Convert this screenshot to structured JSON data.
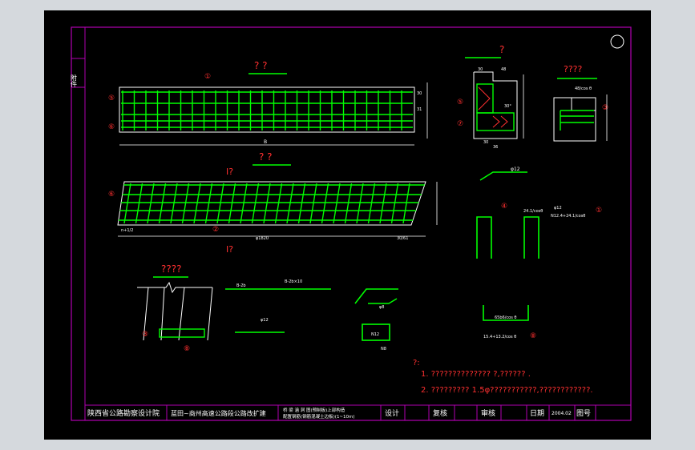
{
  "colors": {
    "background": "#d5d9dd",
    "sheet": "#000000",
    "border": "#b000b0",
    "rebar": "#00ff00",
    "line": "#ffffff",
    "dimension": "#ff3030",
    "title": "#ff3030",
    "text": "#ffffff"
  },
  "side_tab": "附件",
  "views": {
    "top_title": "? ?",
    "mid_title": "? ?",
    "section_title": "?",
    "detail_title": "????",
    "cut_mark_1": "I?",
    "cut_mark_2": "I?",
    "detail_a_title": "????",
    "mid_bottom_label": "n+1/2",
    "small_hook_label": "φ12",
    "bar_labels": {
      "b1": "B-2b",
      "b2": "B-2b×10",
      "b3": "φ12",
      "b4": "φ8",
      "b5": "N8",
      "b6": "N12",
      "b7": "65b6/cos θ",
      "b8": "15.4+13.2/cos θ",
      "b9": "24.1/cosθ",
      "b10": "N12.4+24.1/cosθ",
      "b11": "φ12"
    },
    "dim_labels": {
      "top_len": "B",
      "right_1": "30",
      "right_2": "31",
      "sec_1": "30",
      "sec_2": "48",
      "sec_3": "30",
      "sec_4": "36",
      "sec_5": "30°",
      "det_1": "48/cos θ",
      "mid_len": "φ1820",
      "mid_right": "30/61"
    },
    "circle_marks": [
      "①",
      "②",
      "③",
      "④",
      "⑤",
      "⑥",
      "⑦",
      "⑧"
    ]
  },
  "notes": {
    "heading": "?:",
    "line1": "1. ??????????????      ?,??????     .",
    "line2": "2. ?????????    1.5φ???????????,????????????."
  },
  "title_block": {
    "institute": "陕西省公路勘察设计院",
    "project": "蓝田~商州高速公路段公路改扩建",
    "drawing_line1": "桥 梁 涵 洞 图(预制板)上部构造",
    "drawing_line2": "配置钢筋(钢筋混凝土边板)(1~10m)",
    "design": "设计",
    "review": "复核",
    "approve": "审核",
    "date_label": "日期",
    "date_value": "2004.02",
    "drawing_no": "图号"
  }
}
